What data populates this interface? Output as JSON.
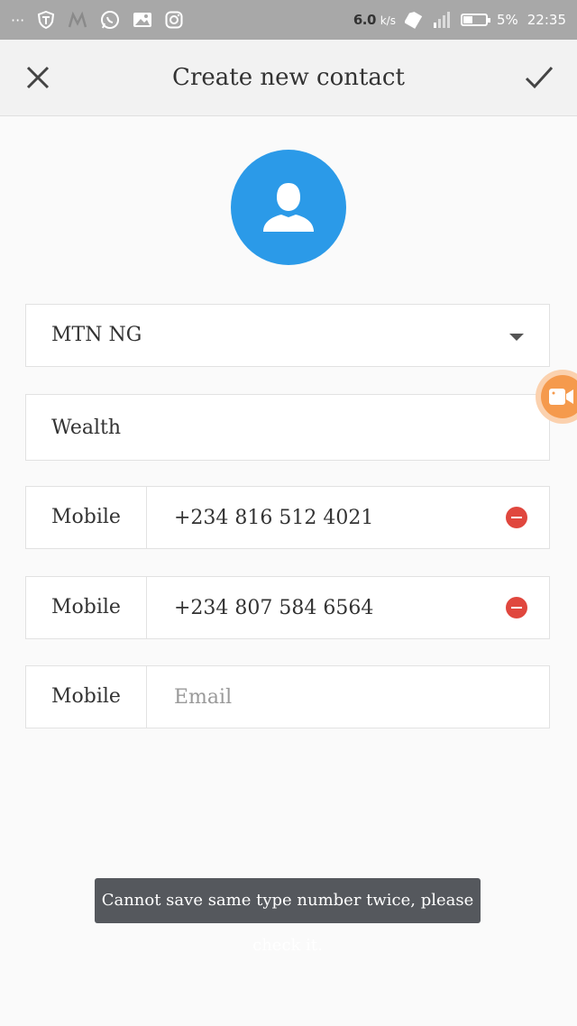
{
  "status_bar": {
    "dots": "···",
    "speed": "6.0",
    "speed_unit": "k/s",
    "battery_percent_text": "5%",
    "time": "22:35",
    "battery_level": 0.4,
    "icons": [
      "shield-icon",
      "mi-icon",
      "whatsapp-icon",
      "image-icon",
      "instagram-icon",
      "sim-icon",
      "signal-icon",
      "battery-icon"
    ]
  },
  "header": {
    "title": "Create new contact",
    "close_icon": "close-icon",
    "save_icon": "check-icon"
  },
  "avatar": {
    "icon": "person-icon",
    "color": "#2b9ae8"
  },
  "account": {
    "selected": "MTN NG",
    "icon": "dropdown-caret-icon"
  },
  "name_field": {
    "value": "Wealth"
  },
  "phones": [
    {
      "type": "Mobile",
      "value": "+234 816 512 4021"
    },
    {
      "type": "Mobile",
      "value": "+234 807 584 6564"
    }
  ],
  "email": {
    "type": "Mobile",
    "placeholder": "Email",
    "value": ""
  },
  "toast": {
    "message": "Cannot save same type number twice, please check it."
  },
  "colors": {
    "accent": "#2b9ae8",
    "remove": "#e0473e",
    "floating_button": "#f59a4d",
    "toast_bg": "#55585d"
  }
}
